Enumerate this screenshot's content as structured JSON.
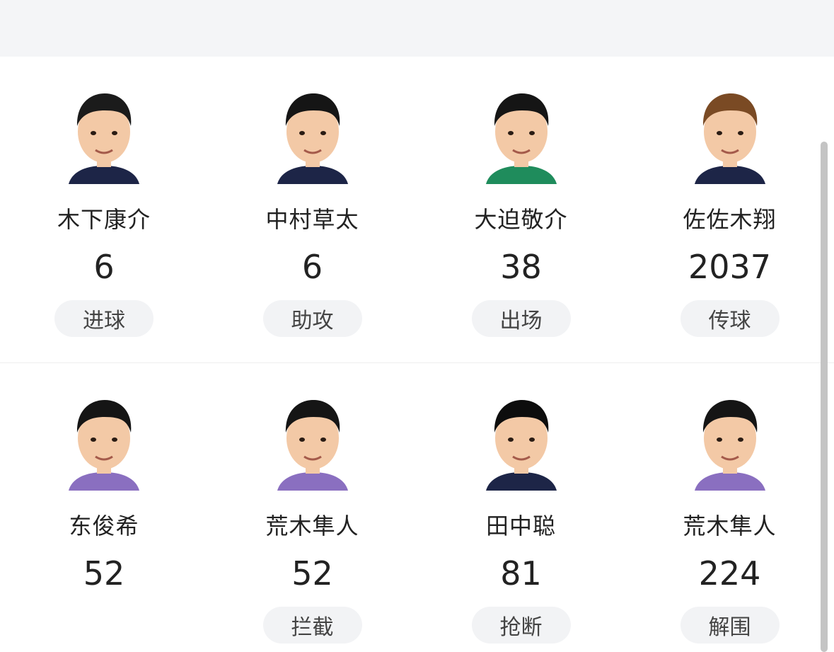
{
  "players": [
    {
      "name": "木下康介",
      "value": "6",
      "stat": "进球",
      "jersey": "#1d2547",
      "hair": "#1b1b1b"
    },
    {
      "name": "中村草太",
      "value": "6",
      "stat": "助攻",
      "jersey": "#1d2547",
      "hair": "#151515"
    },
    {
      "name": "大迫敬介",
      "value": "38",
      "stat": "出场",
      "jersey": "#1f8c5c",
      "hair": "#151515"
    },
    {
      "name": "佐佐木翔",
      "value": "2037",
      "stat": "传球",
      "jersey": "#1d2547",
      "hair": "#7a4a24"
    },
    {
      "name": "东俊希",
      "value": "52",
      "stat": "",
      "jersey": "#8a6fc0",
      "hair": "#151515"
    },
    {
      "name": "荒木隼人",
      "value": "52",
      "stat": "拦截",
      "jersey": "#8a6fc0",
      "hair": "#151515"
    },
    {
      "name": "田中聪",
      "value": "81",
      "stat": "抢断",
      "jersey": "#1d2547",
      "hair": "#0d0d0d"
    },
    {
      "name": "荒木隼人",
      "value": "224",
      "stat": "解围",
      "jersey": "#8a6fc0",
      "hair": "#151515"
    }
  ],
  "colors": {
    "top_band": "#f4f5f7",
    "pill_bg": "#f2f3f5",
    "skin": "#f3c9a6"
  }
}
